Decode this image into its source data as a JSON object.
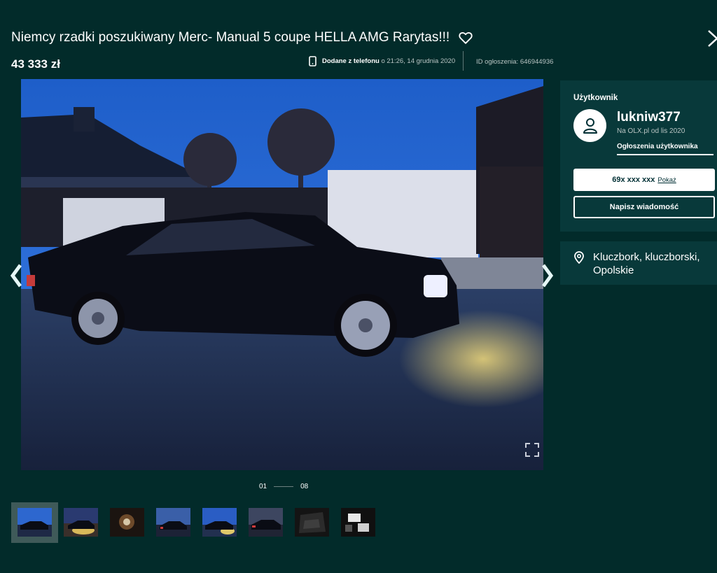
{
  "listing": {
    "title": "Niemcy rzadki poszukiwany Merc- Manual 5 coupe HELLA AMG Rarytas!!!",
    "price": "43 333 zł",
    "added_label": "Dodane z telefonu",
    "added_time": "o 21:26, 14 grudnia 2020",
    "ad_id": "ID ogłoszenia: 646944936"
  },
  "gallery": {
    "current": "01",
    "total": "08",
    "thumbnails": [
      "thumb-1",
      "thumb-2",
      "thumb-3",
      "thumb-4",
      "thumb-5",
      "thumb-6",
      "thumb-7",
      "thumb-8"
    ]
  },
  "user": {
    "heading": "Użytkownik",
    "name": "lukniw377",
    "since": "Na OLX.pl od lis 2020",
    "ads_link": "Ogłoszenia użytkownika",
    "phone": "69x xxx xxx",
    "show_label": "Pokaż",
    "message_label": "Napisz wiadomość"
  },
  "location": {
    "text": "Kluczbork, kluczborski, Opolskie"
  },
  "icons": {
    "favorite": "heart-icon",
    "close": "close-icon",
    "phone": "phone-icon",
    "avatar": "user-icon",
    "location": "location-pin-icon",
    "expand": "fullscreen-icon"
  }
}
